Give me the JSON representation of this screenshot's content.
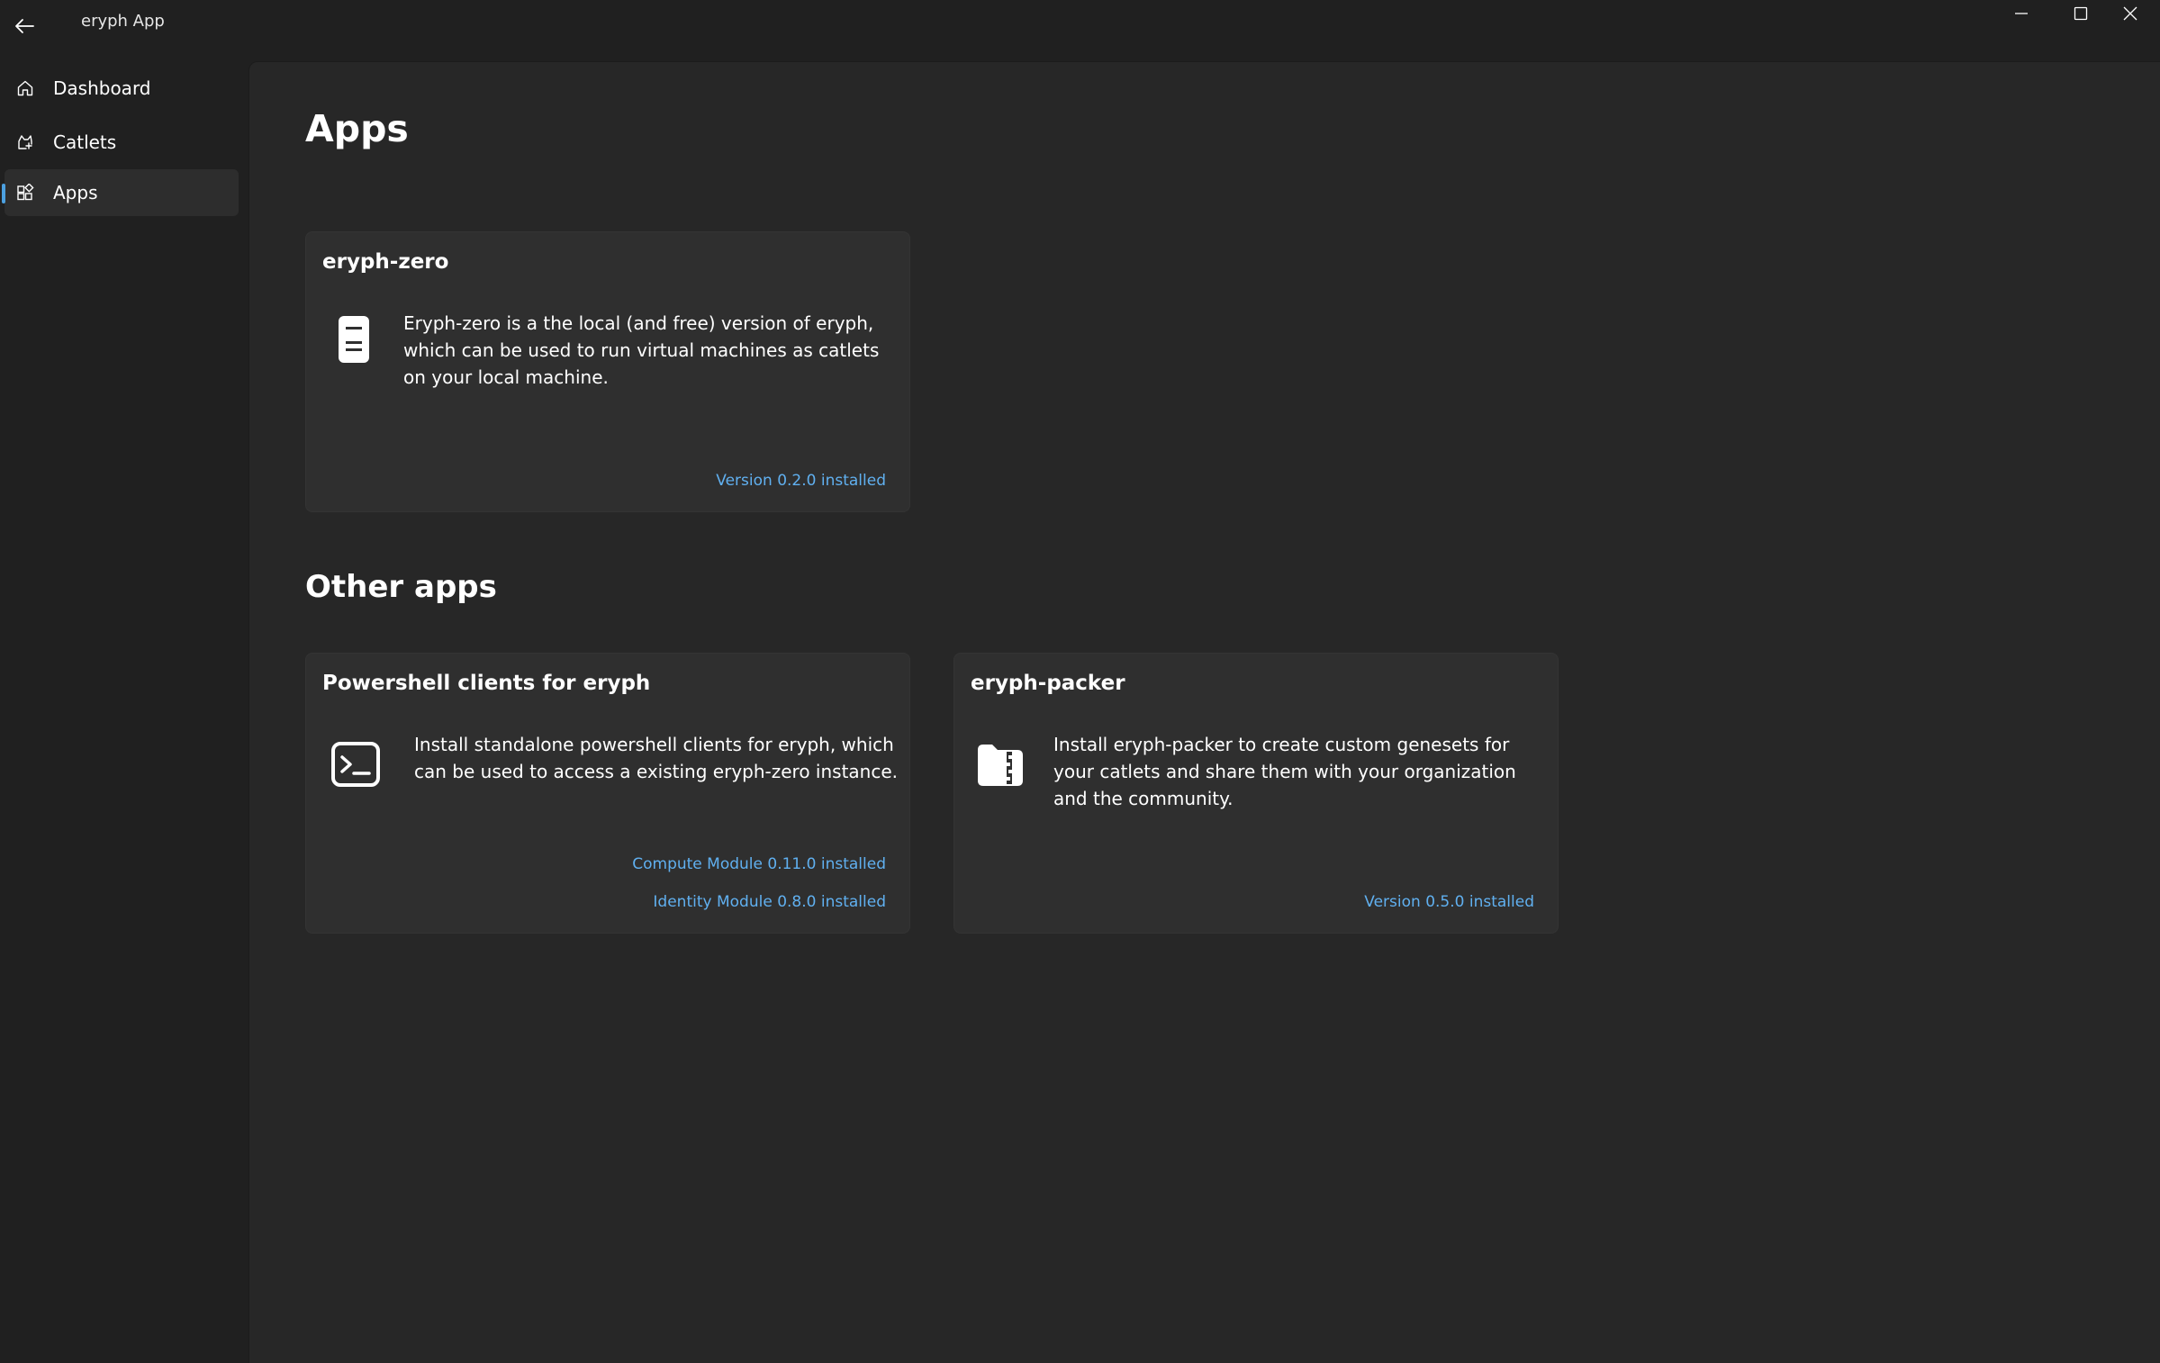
{
  "window": {
    "title": "eryph App",
    "back_icon": "back-arrow-icon",
    "controls": [
      "minimize-icon",
      "maximize-icon",
      "close-icon"
    ]
  },
  "sidebar": {
    "items": [
      {
        "label": "Dashboard",
        "icon": "home-icon",
        "selected": false
      },
      {
        "label": "Catlets",
        "icon": "catlet-icon",
        "selected": false
      },
      {
        "label": "Apps",
        "icon": "apps-grid-icon",
        "selected": true
      }
    ]
  },
  "main": {
    "page_title": "Apps",
    "featured": {
      "title": "eryph-zero",
      "icon": "server-icon",
      "description": "Eryph-zero is a the local (and free) version of eryph, which can be used to run virtual machines as catlets on your local machine.",
      "status": "Version 0.2.0 installed"
    },
    "other_title": "Other apps",
    "other": [
      {
        "title": "Powershell clients for eryph",
        "icon": "terminal-icon",
        "description": "Install standalone powershell clients for eryph, which can be used to access a existing eryph-zero instance.",
        "status": [
          "Compute Module 0.11.0 installed",
          "Identity Module 0.8.0 installed"
        ]
      },
      {
        "title": "eryph-packer",
        "icon": "package-icon",
        "description": "Install eryph-packer to create custom genesets for your catlets and share them with your organization and the community.",
        "status": [
          "Version 0.5.0 installed"
        ]
      }
    ]
  },
  "colors": {
    "accent": "#4ca0e0",
    "link": "#60b0f0",
    "window_bg": "#202020",
    "content_bg": "#272727",
    "card_bg": "#2f2f2f"
  }
}
